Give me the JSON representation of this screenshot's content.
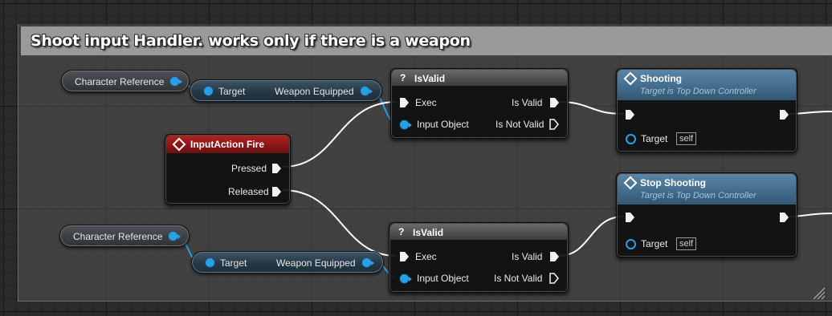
{
  "comment": {
    "title": "Shoot input Handler. works only if there is a weapon"
  },
  "nodes": {
    "char_ref_1": {
      "label": "Character Reference"
    },
    "char_ref_2": {
      "label": "Character Reference"
    },
    "get_weapon_1": {
      "target": "Target",
      "output": "Weapon Equipped"
    },
    "get_weapon_2": {
      "target": "Target",
      "output": "Weapon Equipped"
    },
    "input_action": {
      "title": "InputAction Fire",
      "pressed": "Pressed",
      "released": "Released"
    },
    "isvalid_1": {
      "glyph": "?",
      "title": "IsValid",
      "exec": "Exec",
      "input_object": "Input Object",
      "is_valid": "Is Valid",
      "is_not_valid": "Is Not Valid"
    },
    "isvalid_2": {
      "glyph": "?",
      "title": "IsValid",
      "exec": "Exec",
      "input_object": "Input Object",
      "is_valid": "Is Valid",
      "is_not_valid": "Is Not Valid"
    },
    "shooting": {
      "title": "Shooting",
      "subtitle": "Target is Top Down Controller",
      "target": "Target",
      "self": "self"
    },
    "stop_shooting": {
      "title": "Stop Shooting",
      "subtitle": "Target is Top Down Controller",
      "target": "Target",
      "self": "self"
    }
  },
  "colors": {
    "object_pin": "#27a0e8",
    "exec_wire": "#ffffff",
    "event_header": "#9b1a1a",
    "function_header": "#4a7596",
    "macro_header": "#5a5a5a"
  }
}
